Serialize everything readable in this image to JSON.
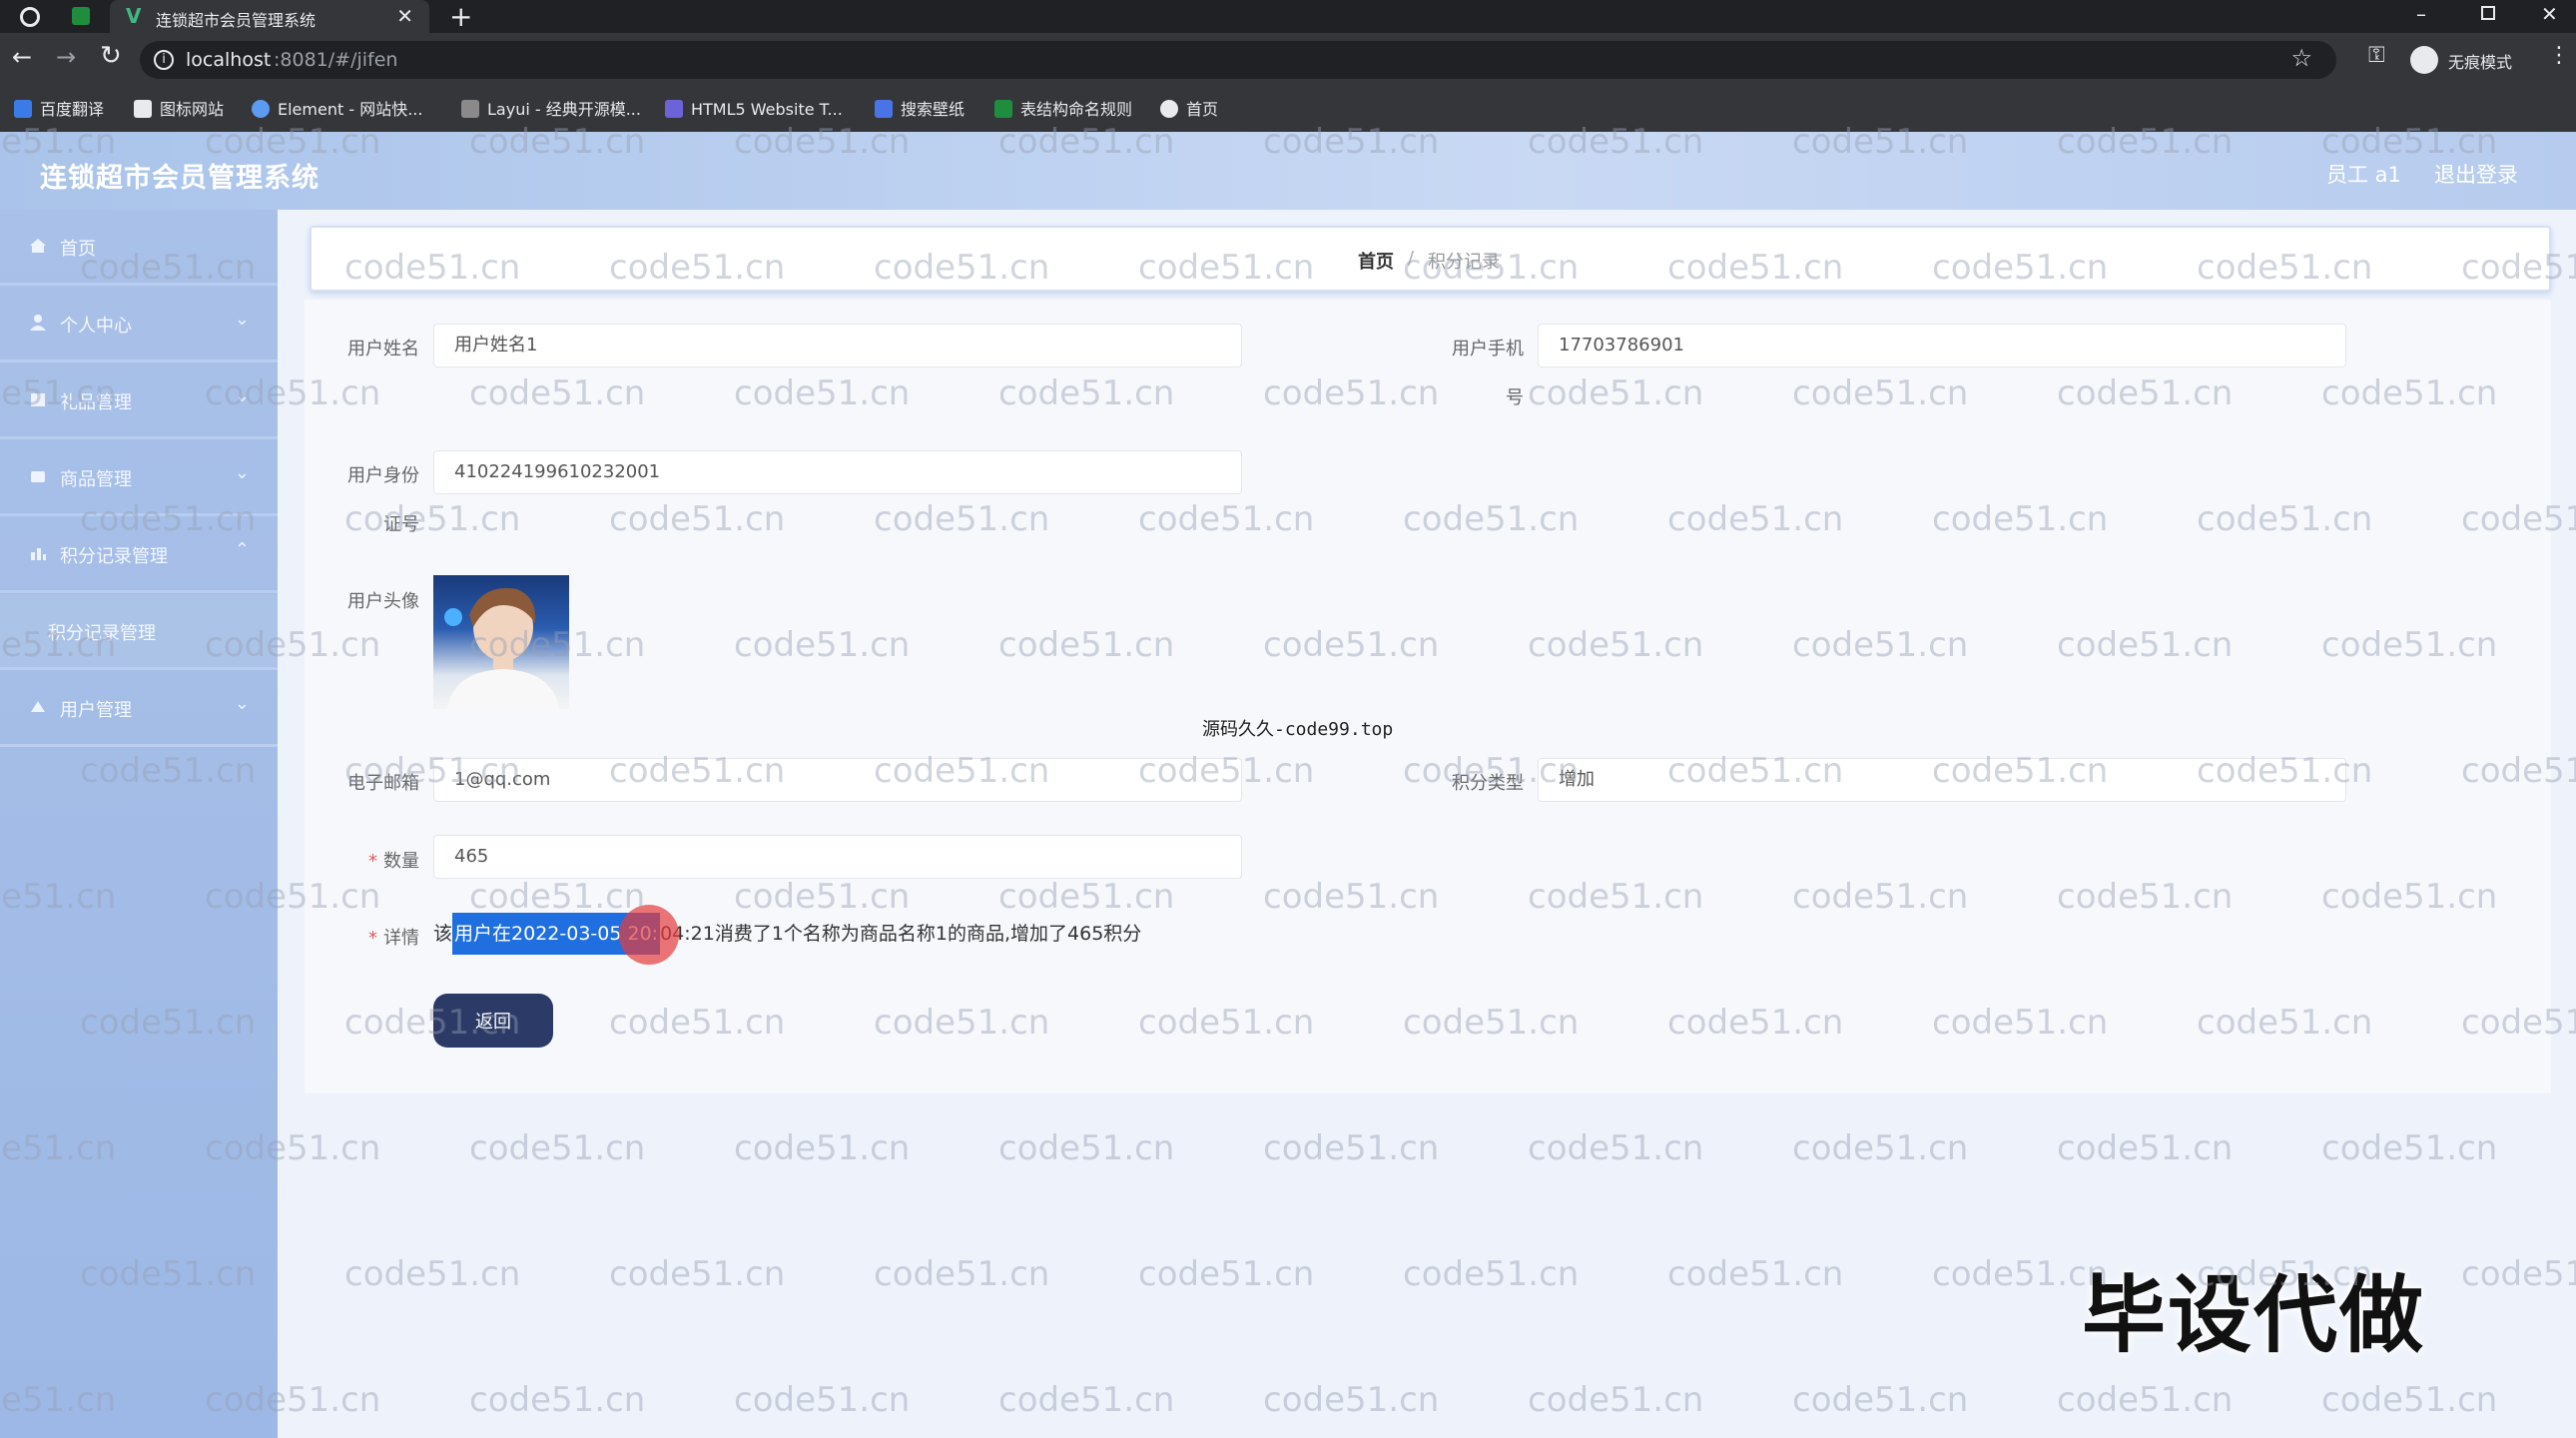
{
  "browser": {
    "tab_title": "连锁超市会员管理系统",
    "url_host": "localhost",
    "url_rest": ":8081/#/jifen",
    "profile_label": "无痕模式",
    "bookmarks": [
      "百度翻译",
      "图标网站",
      "Element - 网站快...",
      "Layui - 经典开源模...",
      "HTML5 Website T...",
      "搜索壁纸",
      "表结构命名规则",
      "首页"
    ]
  },
  "app": {
    "title": "连锁超市会员管理系统",
    "user_label": "员工 a1",
    "logout_label": "退出登录"
  },
  "sidebar": {
    "items": [
      {
        "label": "首页",
        "icon": "home-icon"
      },
      {
        "label": "个人中心",
        "icon": "user-icon"
      },
      {
        "label": "礼品管理",
        "icon": "gift-icon"
      },
      {
        "label": "商品管理",
        "icon": "goods-icon"
      },
      {
        "label": "积分记录管理",
        "icon": "points-icon"
      },
      {
        "label": "积分记录管理",
        "icon": ""
      },
      {
        "label": "用户管理",
        "icon": "users-icon"
      }
    ]
  },
  "breadcrumb": {
    "home": "首页",
    "sep": "/",
    "current": "积分记录"
  },
  "form": {
    "username_label": "用户姓名",
    "username_value": "用户姓名1",
    "phone_label": "用户手机",
    "phone_label_wrap": "号",
    "phone_value": "17703786901",
    "idcard_label": "用户身份",
    "idcard_label_wrap": "证号",
    "idcard_value": "410224199610232001",
    "avatar_label": "用户头像",
    "email_label": "电子邮箱",
    "email_value": "1@qq.com",
    "points_type_label": "积分类型",
    "points_type_value": "增加",
    "quantity_label": "数量",
    "quantity_value": "465",
    "detail_label": "详情",
    "detail_prefix": "该",
    "detail_selected": "用户在2022-03-05 20:",
    "detail_rest": "04:21消费了1个名称为商品名称1的商品,增加了465积分",
    "back_button": "返回"
  },
  "overlay": {
    "center_text": "源码久久-code99.top",
    "corner_text": "毕设代做",
    "watermark": "code51.cn"
  }
}
